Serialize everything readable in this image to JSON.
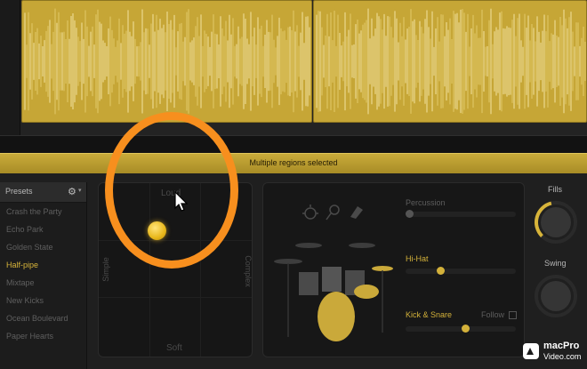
{
  "banner": {
    "text": "Multiple regions selected"
  },
  "presets": {
    "title": "Presets",
    "gear_icon": "gear-icon",
    "items": [
      {
        "label": "Crash the Party",
        "active": false
      },
      {
        "label": "Echo Park",
        "active": false
      },
      {
        "label": "Golden State",
        "active": false
      },
      {
        "label": "Half-pipe",
        "active": true
      },
      {
        "label": "Mixtape",
        "active": false
      },
      {
        "label": "New Kicks",
        "active": false
      },
      {
        "label": "Ocean Boulevard",
        "active": false
      },
      {
        "label": "Paper Hearts",
        "active": false
      }
    ]
  },
  "xy_pad": {
    "top_label": "Loud",
    "bottom_label": "Soft",
    "left_label": "Simple",
    "right_label": "Complex"
  },
  "drum_panel": {
    "icons": [
      "clap-icon",
      "shaker-icon",
      "tambourine-icon"
    ],
    "percussion": {
      "label": "Percussion",
      "level": 0.0,
      "enabled": false
    },
    "hihat": {
      "label": "Hi-Hat",
      "level": 0.3,
      "enabled": true
    },
    "kick_snare": {
      "label": "Kick & Snare",
      "level": 0.55,
      "enabled": true
    },
    "follow": {
      "label": "Follow",
      "checked": false
    }
  },
  "right_controls": {
    "fills": {
      "label": "Fills",
      "value": 0.45
    },
    "swing": {
      "label": "Swing",
      "value": 0.0
    }
  },
  "brand": {
    "line1": "macPro",
    "line2": "Video.com"
  },
  "colors": {
    "accent": "#d7b43a",
    "region": "#c6a636",
    "annotation": "#f78f1e"
  }
}
